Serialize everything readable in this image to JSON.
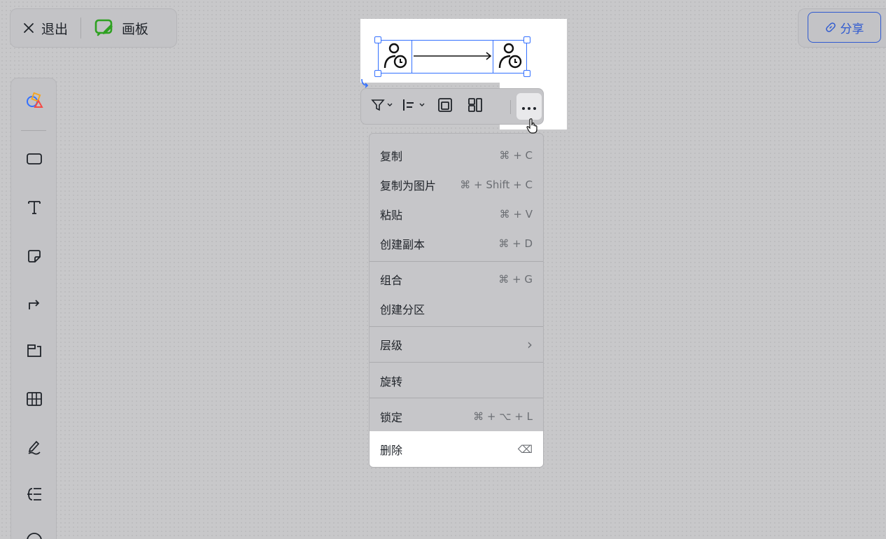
{
  "topbar": {
    "exit_label": "退出",
    "board_label": "画板"
  },
  "share": {
    "label": "分享"
  },
  "leftbar": {
    "tools": [
      {
        "name": "shapes-icon"
      },
      {
        "name": "rectangle-icon"
      },
      {
        "name": "text-icon"
      },
      {
        "name": "sticky-note-icon"
      },
      {
        "name": "connector-icon"
      },
      {
        "name": "frame-icon"
      },
      {
        "name": "table-icon"
      },
      {
        "name": "pen-icon"
      },
      {
        "name": "mindmap-icon"
      }
    ]
  },
  "floatbar": {
    "items": [
      "filter-icon",
      "align-icon",
      "frame-wrap-icon",
      "layout-icon",
      "more-icon"
    ]
  },
  "menu": {
    "items": [
      {
        "label": "复制",
        "shortcut": "⌘ + C"
      },
      {
        "label": "复制为图片",
        "shortcut": "⌘ + Shift + C"
      },
      {
        "label": "粘贴",
        "shortcut": "⌘ + V"
      },
      {
        "label": "创建副本",
        "shortcut": "⌘ + D"
      },
      {
        "label": "组合",
        "shortcut": "⌘ + G"
      },
      {
        "label": "创建分区",
        "shortcut": ""
      },
      {
        "label": "层级",
        "shortcut": "›"
      },
      {
        "label": "旋转",
        "shortcut": ""
      },
      {
        "label": "锁定",
        "shortcut": "⌘ + ⌥ + L"
      },
      {
        "label": "删除",
        "shortcut": "⌫"
      }
    ]
  },
  "colors": {
    "accent": "#3370ff",
    "share_blue": "#2f5ad0",
    "board_green": "#2ea121"
  }
}
